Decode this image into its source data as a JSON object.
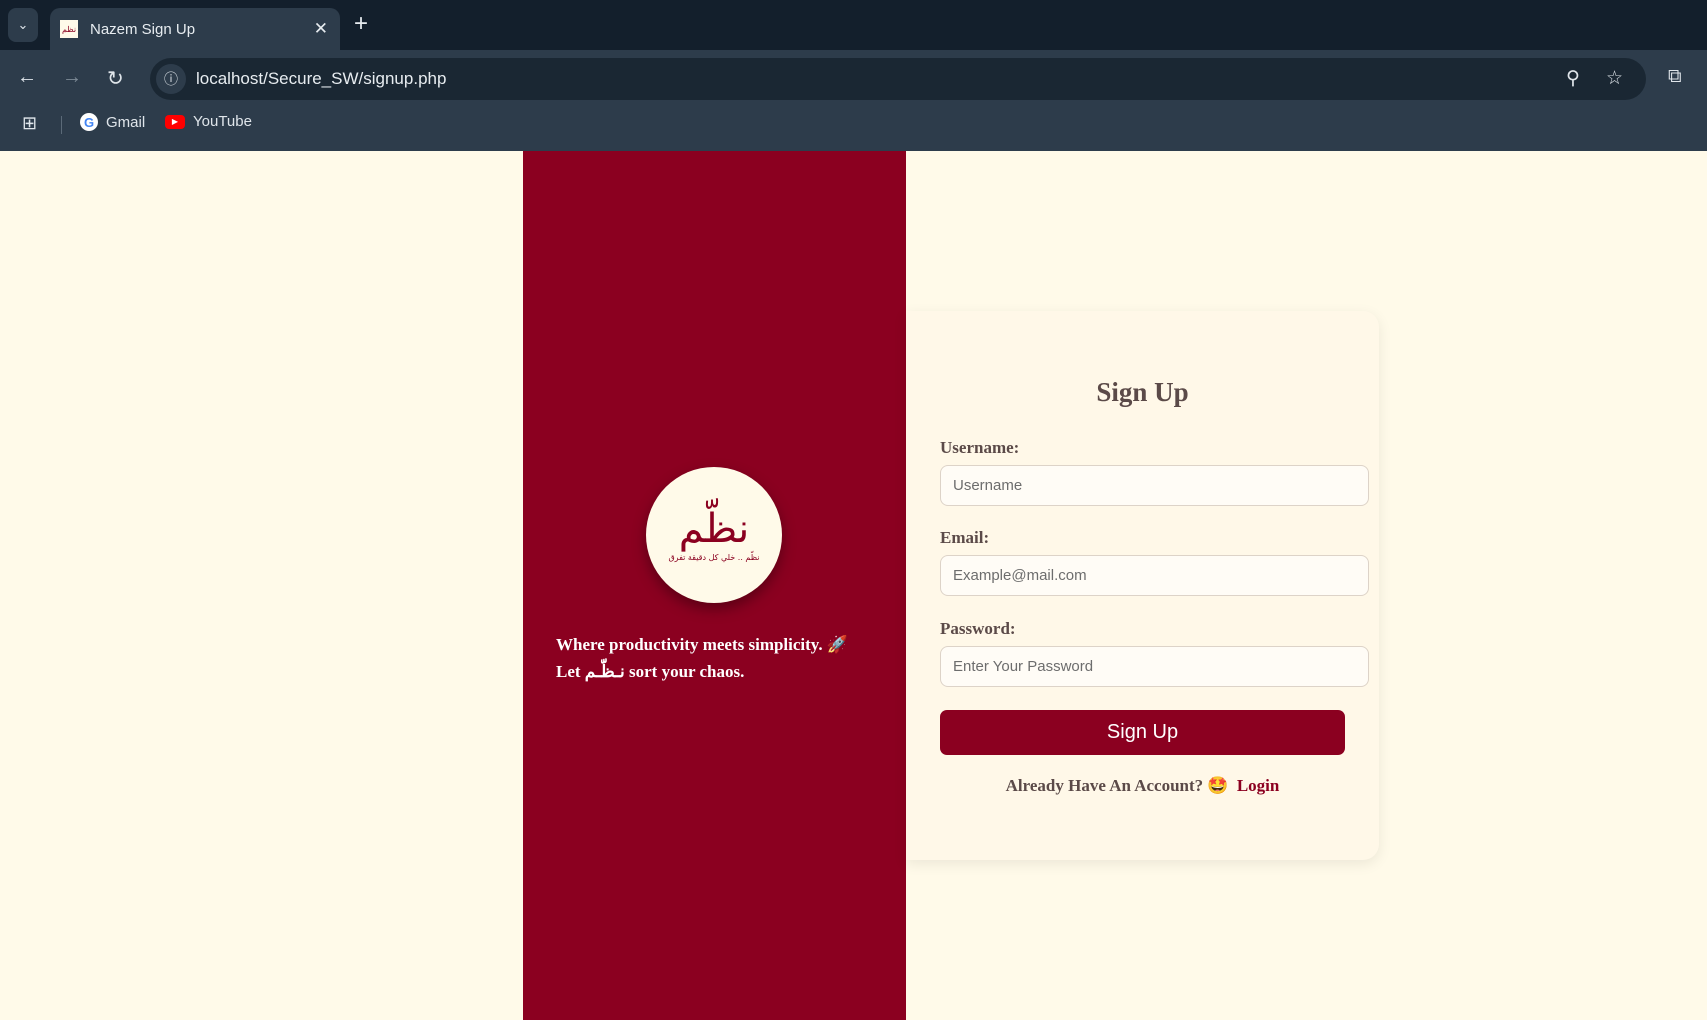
{
  "browser": {
    "tab_title": "Nazem Sign Up",
    "url": "localhost/Secure_SW/signup.php",
    "bookmarks": [
      {
        "label": "Gmail"
      },
      {
        "label": "YouTube"
      }
    ]
  },
  "brand": {
    "logo_text": "نظّم",
    "logo_subtitle": "نظّم .. خلي كل دقيقة تفرق",
    "tagline_line1": "Where productivity meets simplicity. 🚀",
    "tagline_let": "Let",
    "tagline_name": "نـظّـم",
    "tagline_rest": "sort your chaos."
  },
  "form": {
    "title": "Sign Up",
    "username_label": "Username:",
    "username_placeholder": "Username",
    "email_label": "Email:",
    "email_placeholder": "Example@mail.com",
    "password_label": "Password:",
    "password_placeholder": "Enter Your Password",
    "submit_label": "Sign Up",
    "already_text": "Already Have An Account? 🤩",
    "login_label": "Login"
  },
  "colors": {
    "brand": "#8b0020",
    "background": "#fffae9"
  }
}
